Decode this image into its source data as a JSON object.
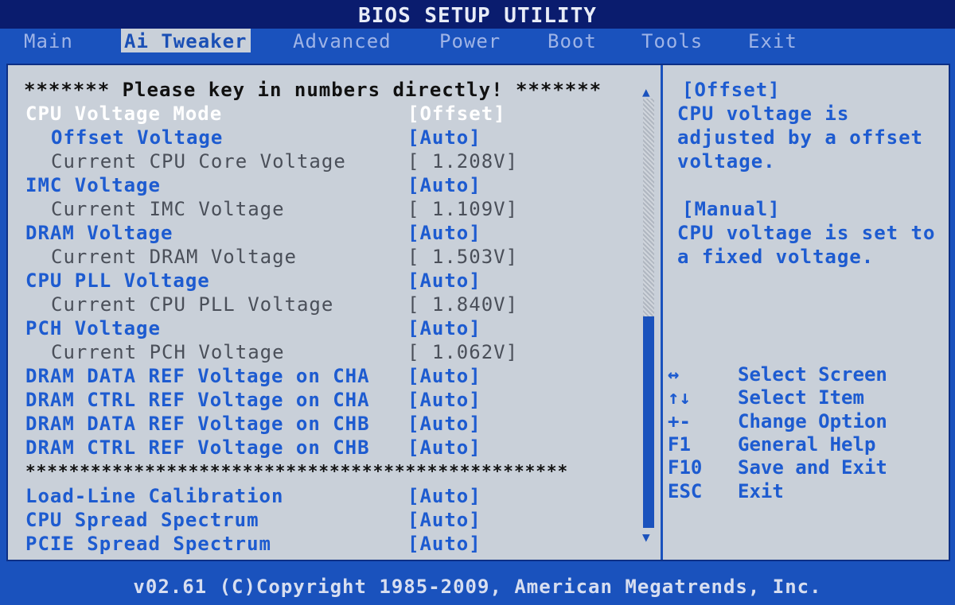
{
  "title": "BIOS SETUP UTILITY",
  "menu": [
    "Main",
    "Ai Tweaker",
    "Advanced",
    "Power",
    "Boot",
    "Tools",
    "Exit"
  ],
  "active_menu": "Ai Tweaker",
  "header_line": "******* Please key in numbers directly! *******",
  "separator_line": "**************************************************",
  "settings": [
    {
      "label": "CPU Voltage Mode",
      "value": "[Offset]"
    },
    {
      "label": "Offset Voltage",
      "value": "[Auto]"
    },
    {
      "label": "Current CPU Core Voltage",
      "value": "[ 1.208V]"
    },
    {
      "label": "IMC Voltage",
      "value": "[Auto]"
    },
    {
      "label": "Current IMC Voltage",
      "value": "[ 1.109V]"
    },
    {
      "label": "DRAM Voltage",
      "value": "[Auto]"
    },
    {
      "label": "Current DRAM Voltage",
      "value": "[ 1.503V]"
    },
    {
      "label": "CPU PLL Voltage",
      "value": "[Auto]"
    },
    {
      "label": "Current CPU PLL Voltage",
      "value": "[ 1.840V]"
    },
    {
      "label": "PCH Voltage",
      "value": "[Auto]"
    },
    {
      "label": "Current PCH Voltage",
      "value": "[ 1.062V]"
    },
    {
      "label": "DRAM DATA REF Voltage on CHA",
      "value": "[Auto]"
    },
    {
      "label": "DRAM CTRL REF Voltage on CHA",
      "value": "[Auto]"
    },
    {
      "label": "DRAM DATA REF Voltage on CHB",
      "value": "[Auto]"
    },
    {
      "label": "DRAM CTRL REF Voltage on CHB",
      "value": "[Auto]"
    },
    {
      "label": "Load-Line Calibration",
      "value": "[Auto]"
    },
    {
      "label": "CPU Spread Spectrum",
      "value": "[Auto]"
    },
    {
      "label": "PCIE Spread Spectrum",
      "value": "[Auto]"
    }
  ],
  "help": {
    "lines": [
      "[Offset]",
      "CPU voltage is",
      "adjusted by a offset",
      "voltage.",
      "",
      "[Manual]",
      "CPU voltage is set to",
      "a fixed voltage."
    ]
  },
  "keys": [
    {
      "key": "↔",
      "desc": "Select Screen"
    },
    {
      "key": "↑↓",
      "desc": "Select Item"
    },
    {
      "key": "+-",
      "desc": "Change Option"
    },
    {
      "key": "F1",
      "desc": "General Help"
    },
    {
      "key": "F10",
      "desc": "Save and Exit"
    },
    {
      "key": "ESC",
      "desc": "Exit"
    }
  ],
  "footer": "v02.61 (C)Copyright 1985-2009, American Megatrends, Inc.",
  "colors": {
    "background": "#1a52bd",
    "panel": "#c9d0d9",
    "highlight": "#1d5bd0",
    "selected": "#ffffff"
  }
}
